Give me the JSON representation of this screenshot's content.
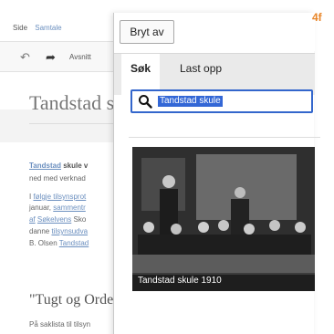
{
  "editor": {
    "tabs": [
      "Side",
      "Samtale"
    ],
    "toolbar_label": "Avsnitt",
    "title": "Tandstad skule",
    "paragraph_lines": [
      [
        "Tandstad",
        " skule v"
      ],
      [
        "ned med verknad"
      ],
      [
        "I ",
        "følgje",
        " tilsynsprot"
      ],
      [
        "januar, ",
        "sammentr"
      ],
      [
        "af",
        " ",
        "Søkelvens",
        " Sko"
      ],
      [
        "danne ",
        "tilsynsudva"
      ],
      [
        "B. Olsen ",
        "Tandstad"
      ]
    ],
    "section_heading": "\"Tugt og Orden\"",
    "section_para": "På saklista til tilsyn"
  },
  "dialog": {
    "cancel_label": "Bryt av",
    "tabs": [
      "Søk",
      "Last opp"
    ],
    "search_value": "Tandstad skule",
    "result_caption": "Tandstad skule 1910"
  },
  "step_label": "4f",
  "colors": {
    "accent": "#3366cc",
    "link": "#6b8fbf",
    "step": "#e8862a"
  }
}
